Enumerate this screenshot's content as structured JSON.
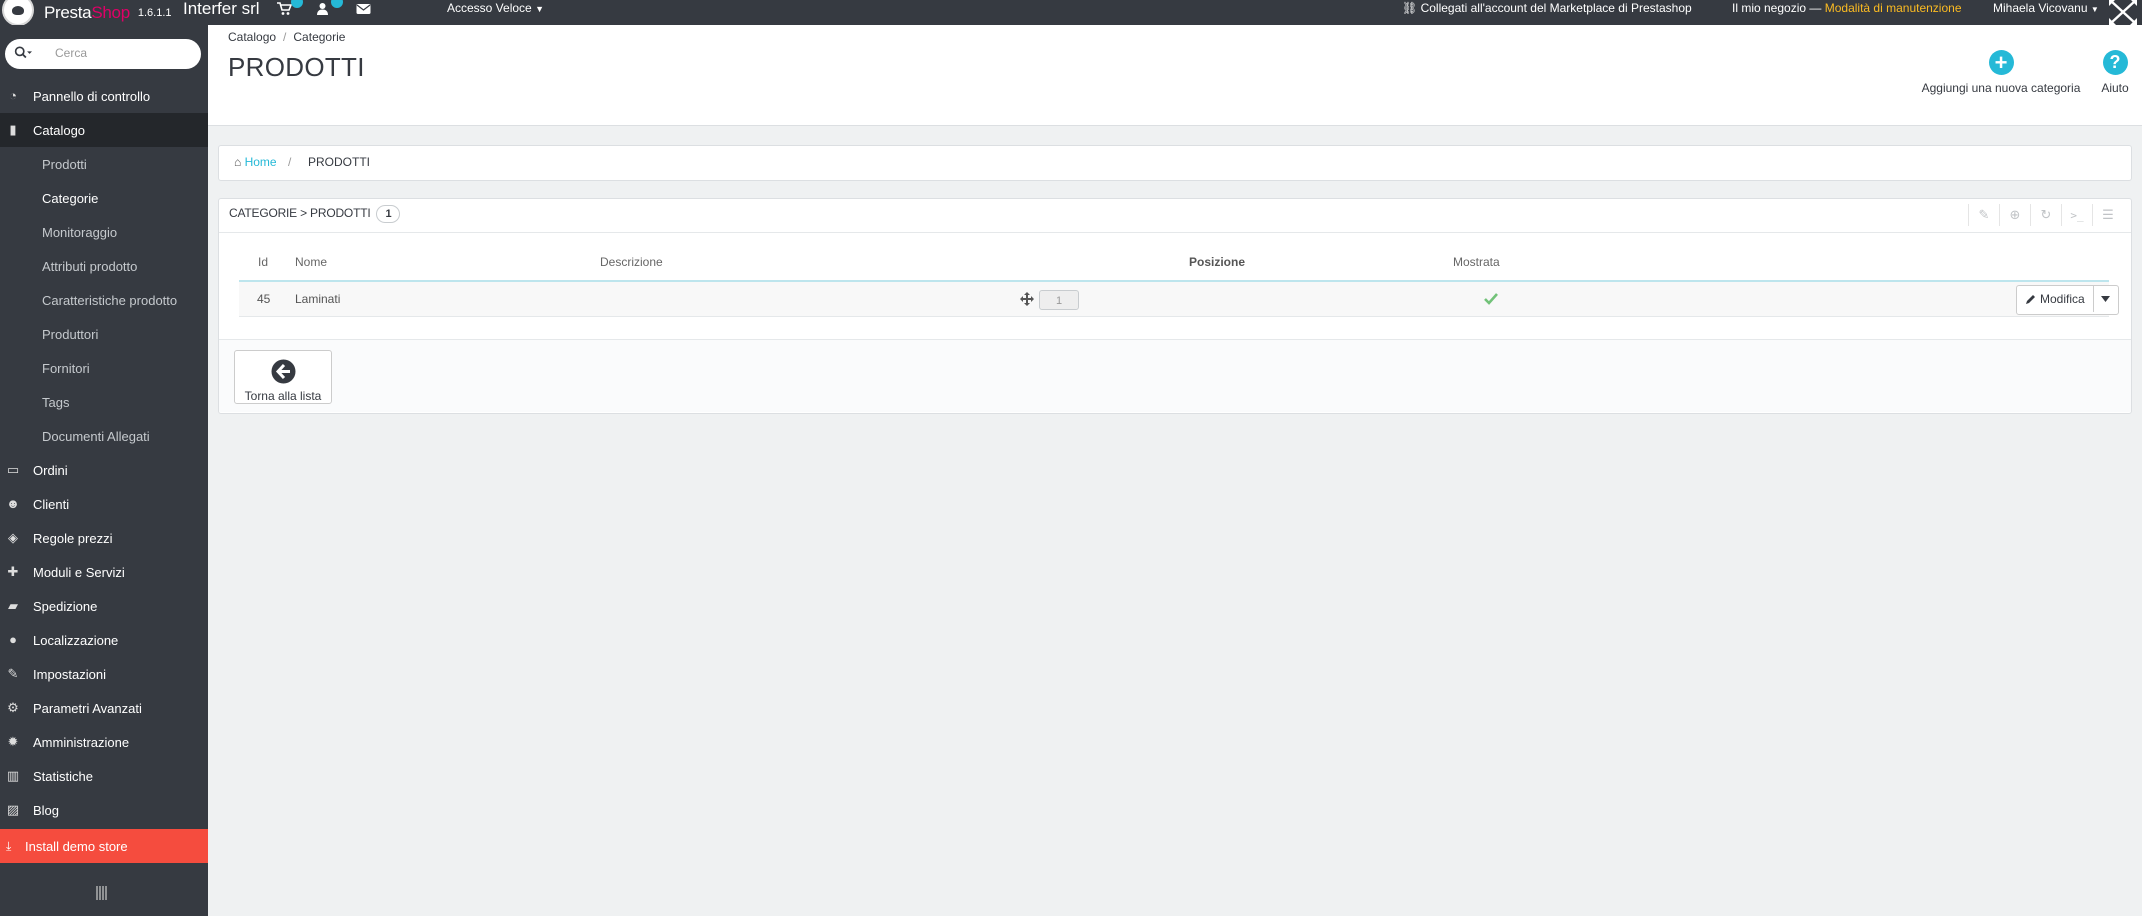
{
  "topbar": {
    "brand_a": "Presta",
    "brand_b": "Shop",
    "version": "1.6.1.1",
    "shop_name": "Interfer srl",
    "quick_access": "Accesso Veloce",
    "marketplace": "Collegati all'account del Marketplace di Prestashop",
    "my_shop": "Il mio negozio",
    "dash": "—",
    "maintenance": "Modalità di manutenzione",
    "user": "Mihaela Vicovanu"
  },
  "search": {
    "placeholder": "Cerca"
  },
  "sidebar": {
    "items": [
      {
        "label": "Pannello di controllo",
        "icon": "dashboard-icon"
      },
      {
        "label": "Catalogo",
        "icon": "book-icon"
      },
      {
        "label": "Ordini",
        "icon": "credit-card-icon"
      },
      {
        "label": "Clienti",
        "icon": "users-icon"
      },
      {
        "label": "Regole prezzi",
        "icon": "tags-icon"
      },
      {
        "label": "Moduli e Servizi",
        "icon": "puzzle-icon"
      },
      {
        "label": "Spedizione",
        "icon": "truck-icon"
      },
      {
        "label": "Localizzazione",
        "icon": "globe-icon"
      },
      {
        "label": "Impostazioni",
        "icon": "wrench-icon"
      },
      {
        "label": "Parametri Avanzati",
        "icon": "cogs-icon"
      },
      {
        "label": "Amministrazione",
        "icon": "cog-icon"
      },
      {
        "label": "Statistiche",
        "icon": "bar-chart-icon"
      },
      {
        "label": "Blog",
        "icon": "edit-icon"
      }
    ],
    "catalog_sub": [
      "Prodotti",
      "Categorie",
      "Monitoraggio",
      "Attributi prodotto",
      "Caratteristiche prodotto",
      "Produttori",
      "Fornitori",
      "Tags",
      "Documenti Allegati"
    ],
    "install": "Install demo store"
  },
  "header": {
    "crumb_1": "Catalogo",
    "crumb_sep": "/",
    "crumb_2": "Categorie",
    "title": "PRODOTTI",
    "add_category": "Aggiungi una nuova categoria",
    "help": "Aiuto"
  },
  "breadcrumb": {
    "home": "Home",
    "sep": "/",
    "current": "PRODOTTI"
  },
  "panel": {
    "heading": "CATEGORIE > PRODOTTI",
    "count": "1",
    "columns": {
      "id": "Id",
      "name": "Nome",
      "description": "Descrizione",
      "position": "Posizione",
      "shown": "Mostrata"
    },
    "rows": [
      {
        "id": "45",
        "name": "Laminati",
        "description": "",
        "position": "1",
        "shown": true
      }
    ],
    "edit": "Modifica",
    "back": "Torna alla lista"
  },
  "colors": {
    "accent": "#25b9d7",
    "sidebar": "#363a41",
    "install": "#f54c3e",
    "maintenance": "#fbbb22",
    "check": "#72c279"
  }
}
